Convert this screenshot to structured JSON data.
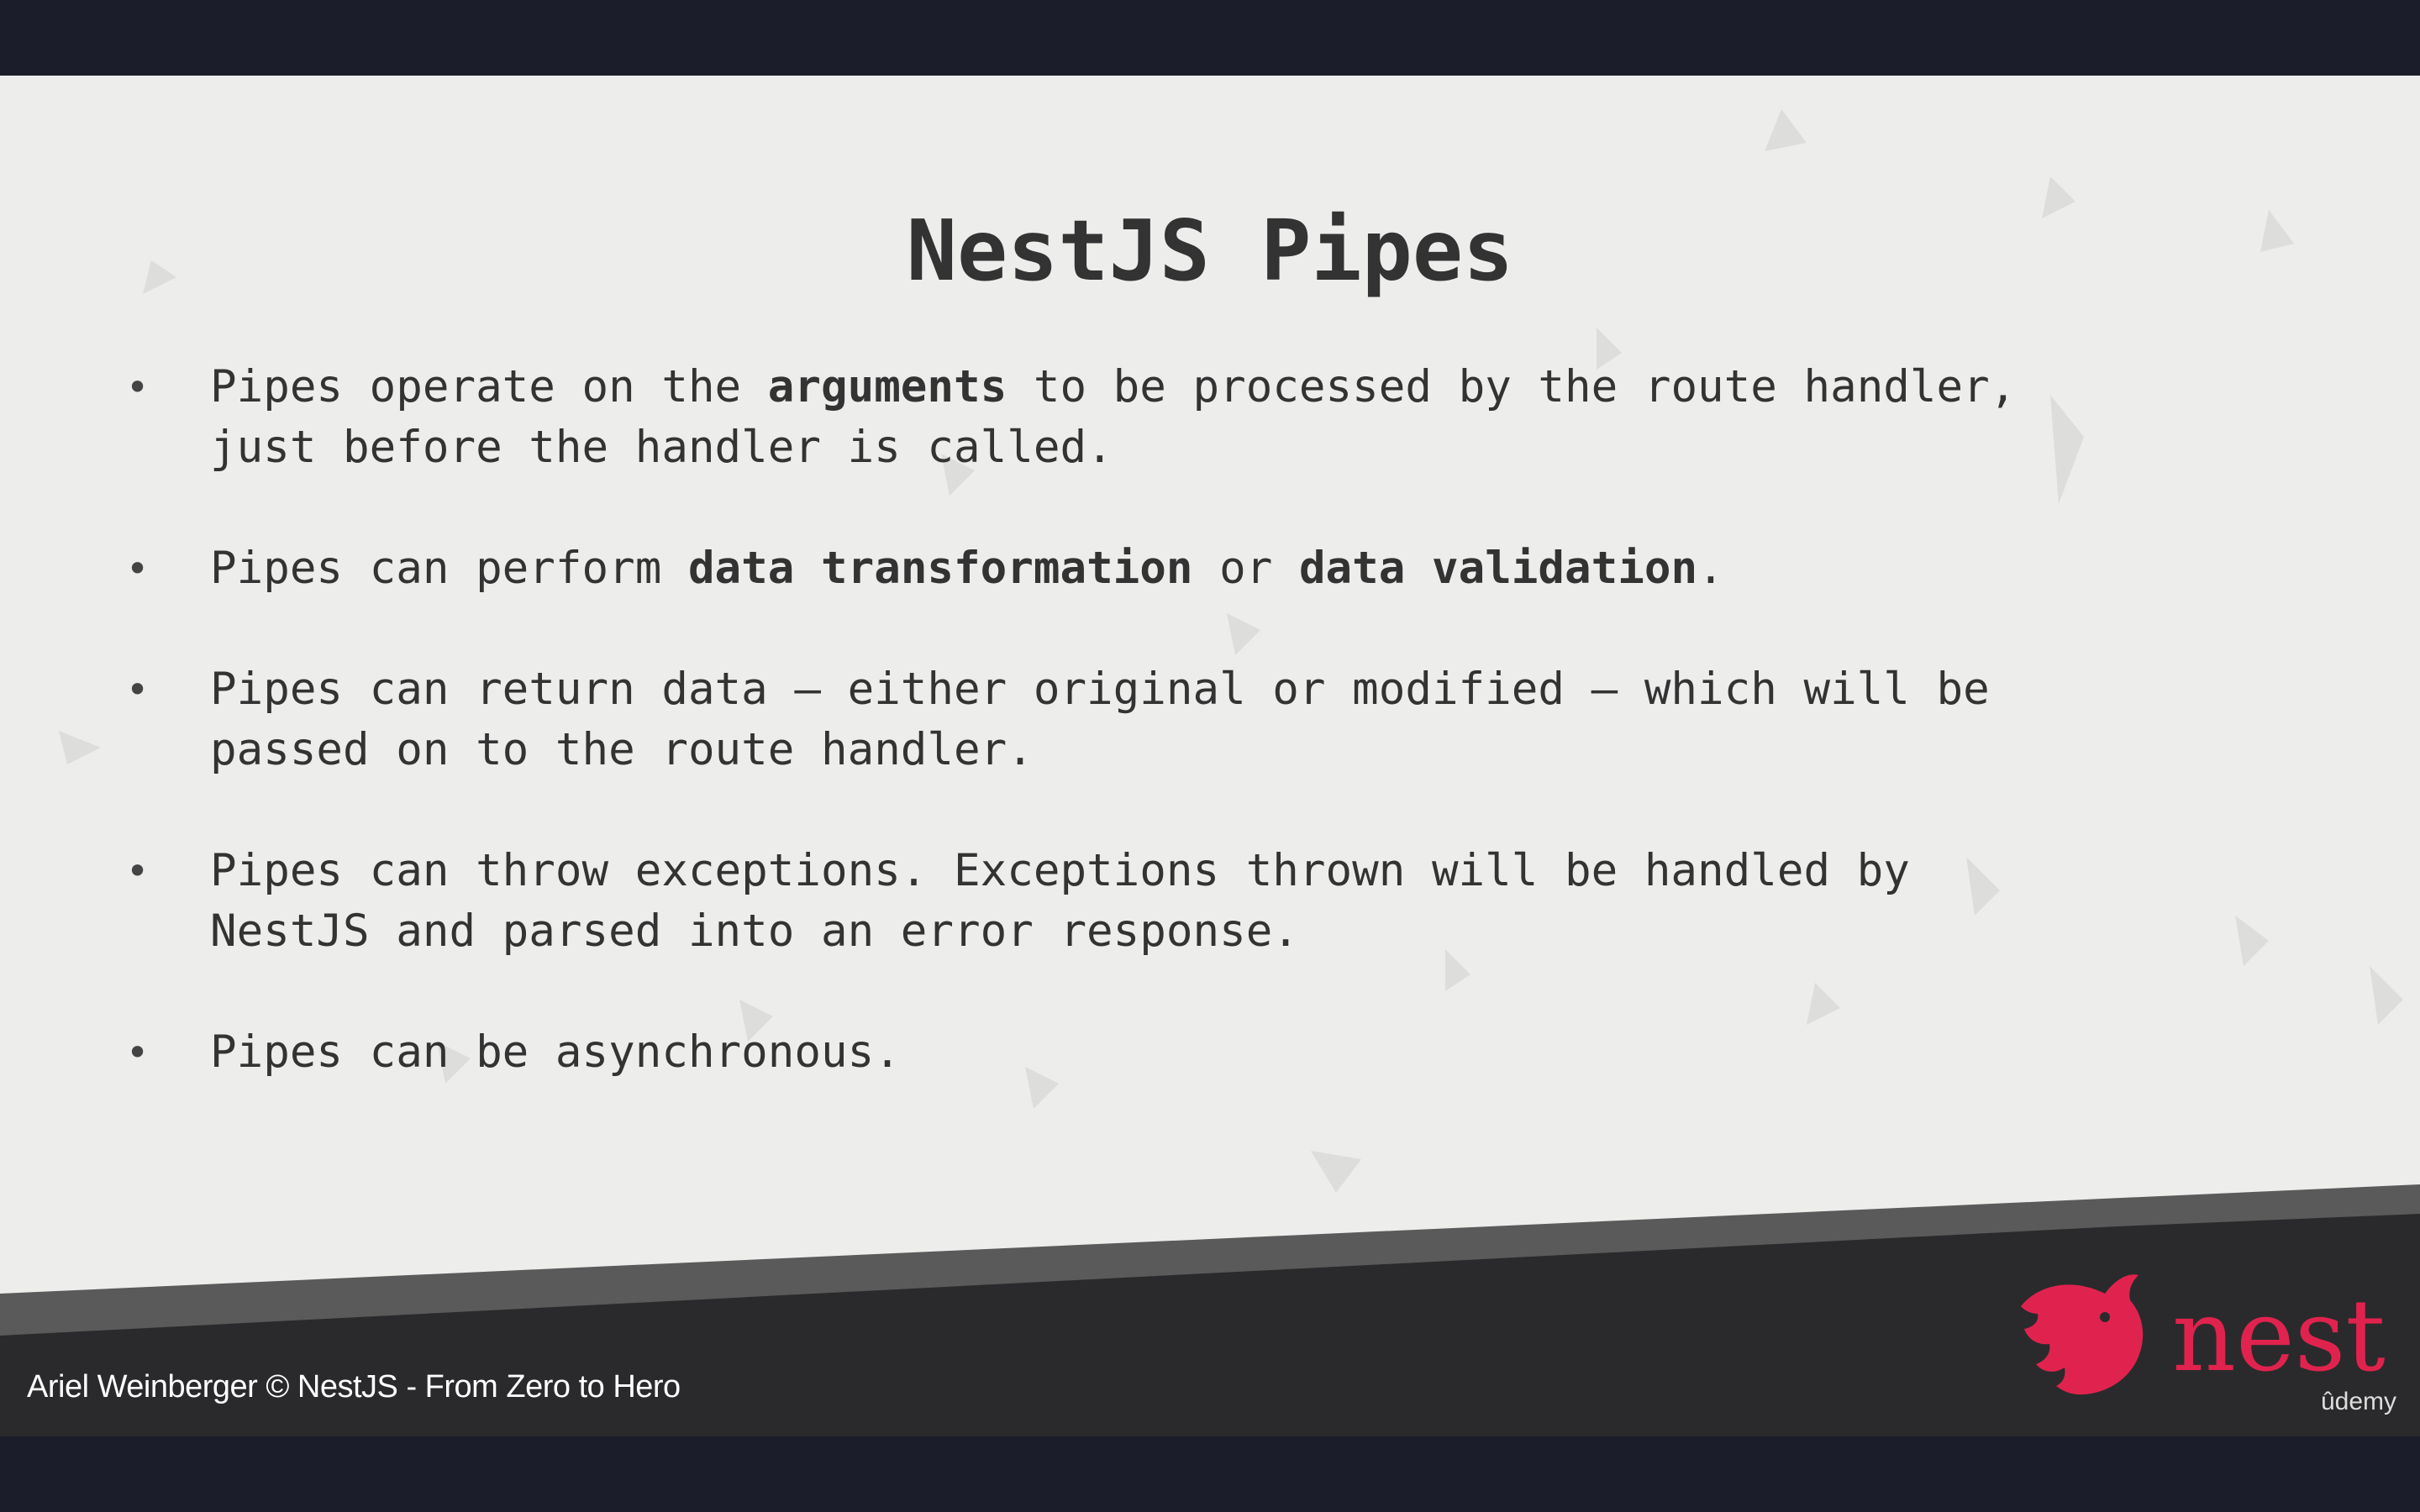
{
  "slide": {
    "title": "NestJS Pipes",
    "bullets": [
      {
        "lines": [
          [
            {
              "text": "Pipes operate on the ",
              "bold": false
            },
            {
              "text": "arguments",
              "bold": true
            },
            {
              "text": " to be processed by the route handler,",
              "bold": false
            }
          ],
          [
            {
              "text": "just before the handler is called.",
              "bold": false
            }
          ]
        ]
      },
      {
        "lines": [
          [
            {
              "text": "Pipes can perform ",
              "bold": false
            },
            {
              "text": "data transformation",
              "bold": true
            },
            {
              "text": " or ",
              "bold": false
            },
            {
              "text": "data validation",
              "bold": true
            },
            {
              "text": ".",
              "bold": false
            }
          ]
        ]
      },
      {
        "lines": [
          [
            {
              "text": "Pipes can return data – either original or modified – which will be",
              "bold": false
            }
          ],
          [
            {
              "text": "passed on to the route handler.",
              "bold": false
            }
          ]
        ]
      },
      {
        "lines": [
          [
            {
              "text": "Pipes can throw exceptions. Exceptions thrown will be handled by",
              "bold": false
            }
          ],
          [
            {
              "text": "NestJS and parsed into an error response.",
              "bold": false
            }
          ]
        ]
      },
      {
        "lines": [
          [
            {
              "text": "Pipes can be asynchronous.",
              "bold": false
            }
          ]
        ]
      }
    ],
    "bullet_glyph": "•"
  },
  "footer": {
    "credit": "Ariel Weinberger © NestJS - From Zero to Hero",
    "logo_text": "nest",
    "watermark": "ûdemy"
  },
  "colors": {
    "slide_background": "#ededec",
    "text": "#333333",
    "footer_dark": "#2a2a2c",
    "footer_mid": "#5a5a5a",
    "brand_red": "#e0234e",
    "letterbox": "#1c1d2b"
  },
  "icons": {
    "logo": "nest-cat-logo-icon"
  }
}
